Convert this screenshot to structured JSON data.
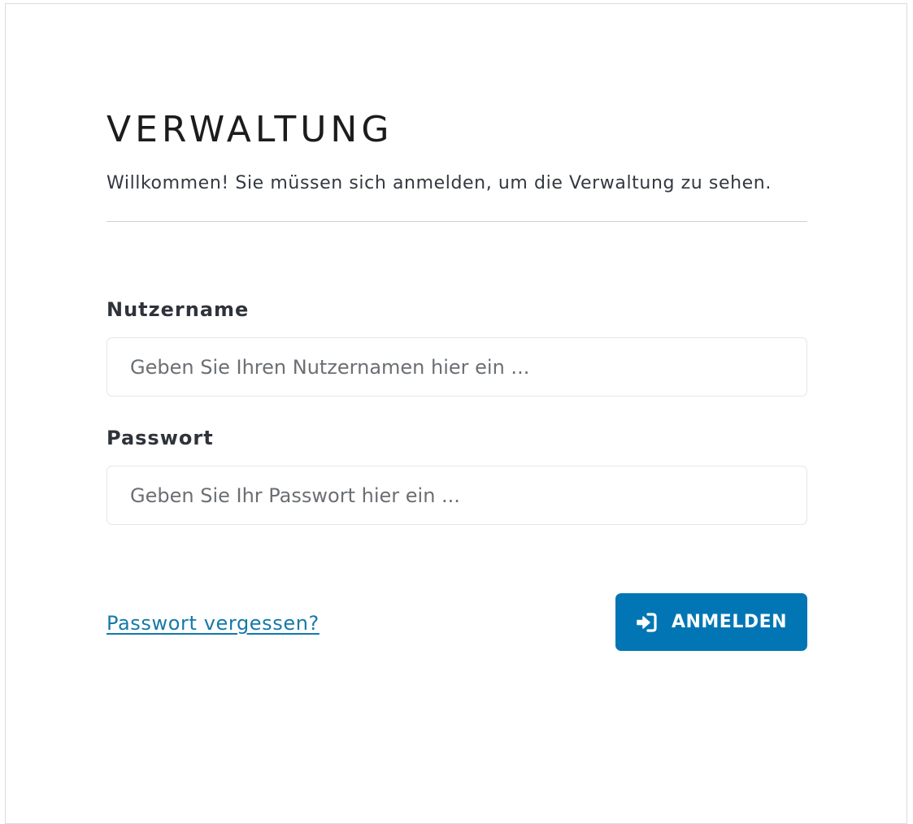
{
  "header": {
    "title": "VERWALTUNG",
    "subtitle": "Willkommen! Sie müssen sich anmelden, um die Verwaltung zu sehen."
  },
  "form": {
    "username": {
      "label": "Nutzername",
      "value": "",
      "placeholder": "Geben Sie Ihren Nutzernamen hier ein ..."
    },
    "password": {
      "label": "Passwort",
      "value": "",
      "placeholder": "Geben Sie Ihr Passwort hier ein ..."
    },
    "forgot_link": "Passwort vergessen?",
    "submit_label": "ANMELDEN",
    "submit_icon": "sign-in-icon"
  },
  "colors": {
    "accent": "#0276b5",
    "link": "#1479a8",
    "title": "#1c1c1c",
    "border": "#e6e6e6"
  }
}
